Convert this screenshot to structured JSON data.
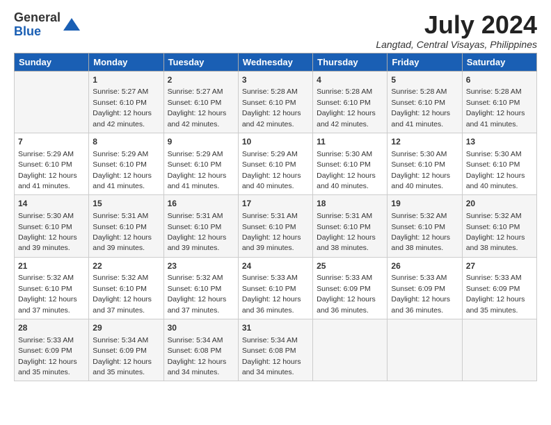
{
  "logo": {
    "general": "General",
    "blue": "Blue"
  },
  "title": {
    "month_year": "July 2024",
    "location": "Langtad, Central Visayas, Philippines"
  },
  "days_of_week": [
    "Sunday",
    "Monday",
    "Tuesday",
    "Wednesday",
    "Thursday",
    "Friday",
    "Saturday"
  ],
  "weeks": [
    [
      {
        "day": "",
        "sunrise": "",
        "sunset": "",
        "daylight": ""
      },
      {
        "day": "1",
        "sunrise": "Sunrise: 5:27 AM",
        "sunset": "Sunset: 6:10 PM",
        "daylight": "Daylight: 12 hours and 42 minutes."
      },
      {
        "day": "2",
        "sunrise": "Sunrise: 5:27 AM",
        "sunset": "Sunset: 6:10 PM",
        "daylight": "Daylight: 12 hours and 42 minutes."
      },
      {
        "day": "3",
        "sunrise": "Sunrise: 5:28 AM",
        "sunset": "Sunset: 6:10 PM",
        "daylight": "Daylight: 12 hours and 42 minutes."
      },
      {
        "day": "4",
        "sunrise": "Sunrise: 5:28 AM",
        "sunset": "Sunset: 6:10 PM",
        "daylight": "Daylight: 12 hours and 42 minutes."
      },
      {
        "day": "5",
        "sunrise": "Sunrise: 5:28 AM",
        "sunset": "Sunset: 6:10 PM",
        "daylight": "Daylight: 12 hours and 41 minutes."
      },
      {
        "day": "6",
        "sunrise": "Sunrise: 5:28 AM",
        "sunset": "Sunset: 6:10 PM",
        "daylight": "Daylight: 12 hours and 41 minutes."
      }
    ],
    [
      {
        "day": "7",
        "sunrise": "Sunrise: 5:29 AM",
        "sunset": "Sunset: 6:10 PM",
        "daylight": "Daylight: 12 hours and 41 minutes."
      },
      {
        "day": "8",
        "sunrise": "Sunrise: 5:29 AM",
        "sunset": "Sunset: 6:10 PM",
        "daylight": "Daylight: 12 hours and 41 minutes."
      },
      {
        "day": "9",
        "sunrise": "Sunrise: 5:29 AM",
        "sunset": "Sunset: 6:10 PM",
        "daylight": "Daylight: 12 hours and 41 minutes."
      },
      {
        "day": "10",
        "sunrise": "Sunrise: 5:29 AM",
        "sunset": "Sunset: 6:10 PM",
        "daylight": "Daylight: 12 hours and 40 minutes."
      },
      {
        "day": "11",
        "sunrise": "Sunrise: 5:30 AM",
        "sunset": "Sunset: 6:10 PM",
        "daylight": "Daylight: 12 hours and 40 minutes."
      },
      {
        "day": "12",
        "sunrise": "Sunrise: 5:30 AM",
        "sunset": "Sunset: 6:10 PM",
        "daylight": "Daylight: 12 hours and 40 minutes."
      },
      {
        "day": "13",
        "sunrise": "Sunrise: 5:30 AM",
        "sunset": "Sunset: 6:10 PM",
        "daylight": "Daylight: 12 hours and 40 minutes."
      }
    ],
    [
      {
        "day": "14",
        "sunrise": "Sunrise: 5:30 AM",
        "sunset": "Sunset: 6:10 PM",
        "daylight": "Daylight: 12 hours and 39 minutes."
      },
      {
        "day": "15",
        "sunrise": "Sunrise: 5:31 AM",
        "sunset": "Sunset: 6:10 PM",
        "daylight": "Daylight: 12 hours and 39 minutes."
      },
      {
        "day": "16",
        "sunrise": "Sunrise: 5:31 AM",
        "sunset": "Sunset: 6:10 PM",
        "daylight": "Daylight: 12 hours and 39 minutes."
      },
      {
        "day": "17",
        "sunrise": "Sunrise: 5:31 AM",
        "sunset": "Sunset: 6:10 PM",
        "daylight": "Daylight: 12 hours and 39 minutes."
      },
      {
        "day": "18",
        "sunrise": "Sunrise: 5:31 AM",
        "sunset": "Sunset: 6:10 PM",
        "daylight": "Daylight: 12 hours and 38 minutes."
      },
      {
        "day": "19",
        "sunrise": "Sunrise: 5:32 AM",
        "sunset": "Sunset: 6:10 PM",
        "daylight": "Daylight: 12 hours and 38 minutes."
      },
      {
        "day": "20",
        "sunrise": "Sunrise: 5:32 AM",
        "sunset": "Sunset: 6:10 PM",
        "daylight": "Daylight: 12 hours and 38 minutes."
      }
    ],
    [
      {
        "day": "21",
        "sunrise": "Sunrise: 5:32 AM",
        "sunset": "Sunset: 6:10 PM",
        "daylight": "Daylight: 12 hours and 37 minutes."
      },
      {
        "day": "22",
        "sunrise": "Sunrise: 5:32 AM",
        "sunset": "Sunset: 6:10 PM",
        "daylight": "Daylight: 12 hours and 37 minutes."
      },
      {
        "day": "23",
        "sunrise": "Sunrise: 5:32 AM",
        "sunset": "Sunset: 6:10 PM",
        "daylight": "Daylight: 12 hours and 37 minutes."
      },
      {
        "day": "24",
        "sunrise": "Sunrise: 5:33 AM",
        "sunset": "Sunset: 6:10 PM",
        "daylight": "Daylight: 12 hours and 36 minutes."
      },
      {
        "day": "25",
        "sunrise": "Sunrise: 5:33 AM",
        "sunset": "Sunset: 6:09 PM",
        "daylight": "Daylight: 12 hours and 36 minutes."
      },
      {
        "day": "26",
        "sunrise": "Sunrise: 5:33 AM",
        "sunset": "Sunset: 6:09 PM",
        "daylight": "Daylight: 12 hours and 36 minutes."
      },
      {
        "day": "27",
        "sunrise": "Sunrise: 5:33 AM",
        "sunset": "Sunset: 6:09 PM",
        "daylight": "Daylight: 12 hours and 35 minutes."
      }
    ],
    [
      {
        "day": "28",
        "sunrise": "Sunrise: 5:33 AM",
        "sunset": "Sunset: 6:09 PM",
        "daylight": "Daylight: 12 hours and 35 minutes."
      },
      {
        "day": "29",
        "sunrise": "Sunrise: 5:34 AM",
        "sunset": "Sunset: 6:09 PM",
        "daylight": "Daylight: 12 hours and 35 minutes."
      },
      {
        "day": "30",
        "sunrise": "Sunrise: 5:34 AM",
        "sunset": "Sunset: 6:08 PM",
        "daylight": "Daylight: 12 hours and 34 minutes."
      },
      {
        "day": "31",
        "sunrise": "Sunrise: 5:34 AM",
        "sunset": "Sunset: 6:08 PM",
        "daylight": "Daylight: 12 hours and 34 minutes."
      },
      {
        "day": "",
        "sunrise": "",
        "sunset": "",
        "daylight": ""
      },
      {
        "day": "",
        "sunrise": "",
        "sunset": "",
        "daylight": ""
      },
      {
        "day": "",
        "sunrise": "",
        "sunset": "",
        "daylight": ""
      }
    ]
  ]
}
